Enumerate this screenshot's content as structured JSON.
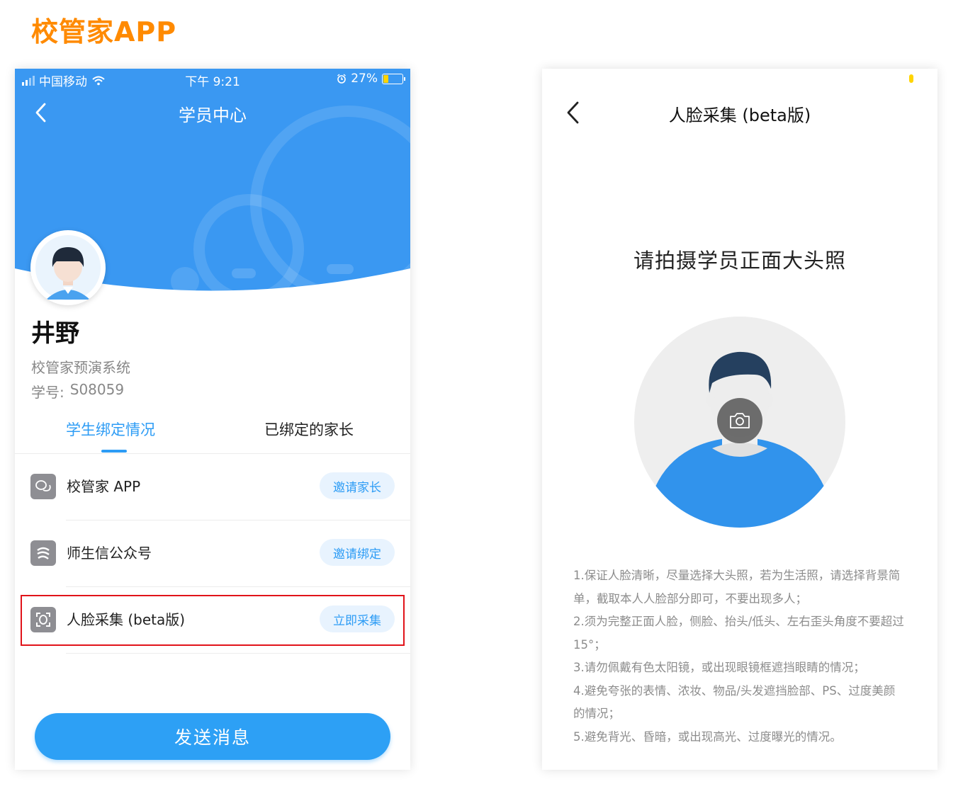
{
  "page_heading": "校管家APP",
  "left_screen": {
    "status_bar": {
      "carrier": "中国移动",
      "time": "下午 9:21",
      "battery": "27%"
    },
    "nav": {
      "title": "学员中心"
    },
    "student": {
      "name": "井野",
      "school": "校管家预演系统",
      "id_label": "学号:",
      "id_value": "S08059"
    },
    "tabs": [
      {
        "label": "学生绑定情况",
        "active": true
      },
      {
        "label": "已绑定的家长",
        "active": false
      }
    ],
    "items": [
      {
        "label": "校管家 APP",
        "action": "邀请家长",
        "icon": "chat-bubbles-icon"
      },
      {
        "label": "师生信公众号",
        "action": "邀请绑定",
        "icon": "wechat-official-icon"
      },
      {
        "label": "人脸采集 (beta版)",
        "action": "立即采集",
        "icon": "face-scan-icon"
      }
    ],
    "send_button": "发送消息",
    "colors": {
      "primary": "#2d9cf5",
      "highlight": "#e1131a",
      "heading": "#ff8a00"
    }
  },
  "right_screen": {
    "nav": {
      "title": "人脸采集 (beta版)"
    },
    "prompt": "请拍摄学员正面大头照",
    "camera_icon": "camera-icon",
    "instructions": [
      "1.保证人脸清晰，尽量选择大头照，若为生活照，请选择背景简单，截取本人人脸部分即可，不要出现多人；",
      "2.须为完整正面人脸，侧脸、抬头/低头、左右歪头角度不要超过15°；",
      "3.请勿佩戴有色太阳镜，或出现眼镜框遮挡眼睛的情况；",
      "4.避免夸张的表情、浓妆、物品/头发遮挡脸部、PS、过度美颜的情况；",
      "5.避免背光、昏暗，或出现高光、过度曝光的情况。"
    ]
  }
}
